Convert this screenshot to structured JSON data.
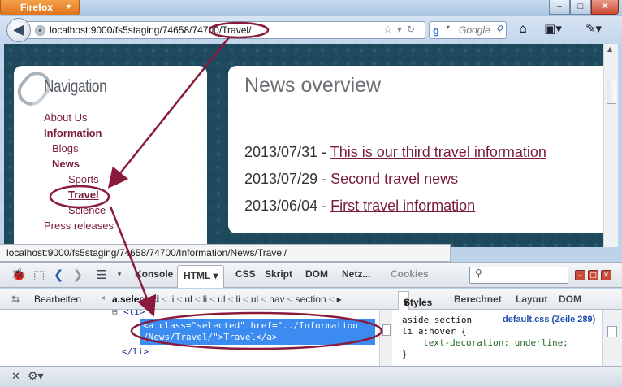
{
  "window": {
    "app_button": "Firefox",
    "min": "–",
    "max": "□",
    "close": "✕"
  },
  "nav": {
    "back_icon": "back-arrow-icon",
    "back_glyph": "◀",
    "url": "localhost:9000/fs5staging/74658/74700/Travel/",
    "search_placeholder": "Google",
    "google_glyph": "g"
  },
  "sidebar": {
    "title": "Navigation",
    "items": [
      {
        "label": "About Us",
        "level": 1
      },
      {
        "label": "Information",
        "level": 1,
        "bold": true
      },
      {
        "label": "Blogs",
        "level": 2
      },
      {
        "label": "News",
        "level": 2,
        "bold": true
      },
      {
        "label": "Sports",
        "level": 3
      },
      {
        "label": "Travel",
        "level": 3,
        "selected": true
      },
      {
        "label": "Science",
        "level": 3
      },
      {
        "label": "Press releases",
        "level": 1
      }
    ]
  },
  "news": {
    "title": "News overview",
    "items": [
      {
        "date": "2013/07/31",
        "sep": " - ",
        "link": "This is our third travel information"
      },
      {
        "date": "2013/07/29",
        "sep": " - ",
        "link": "Second travel news"
      },
      {
        "date": "2013/06/04",
        "sep": " - ",
        "link": "First travel information"
      }
    ]
  },
  "statusbar": {
    "text": "localhost:9000/fs5staging/74658/74700/Information/News/Travel/"
  },
  "firebug": {
    "tabs": [
      "Konsole",
      "HTML",
      "CSS",
      "Skript",
      "DOM",
      "Netz...",
      "Cookies"
    ],
    "selected_tab": "HTML",
    "dropdown_glyph": "▾",
    "breadcrumb_edit": "Bearbeiten",
    "breadcrumbs": [
      "a.selected",
      "li",
      "ul",
      "li",
      "ul",
      "li",
      "ul",
      "nav",
      "section"
    ],
    "html_lines": {
      "li_open": "<li>",
      "li_close": "</li>",
      "selected_1": "<a class=\"selected\" href=\"../Information",
      "selected_2": "/News/Travel/\">Travel</a>"
    },
    "side_tabs": [
      "Styles",
      "Berechnet",
      "Layout",
      "DOM"
    ],
    "css": {
      "selector_1": "aside section",
      "selector_2": "li a:hover {",
      "property": "text-decoration: underline;",
      "close": "}",
      "source": "default.css (Zeile 289)"
    }
  },
  "colors": {
    "accent": "#7a1d3b",
    "highlight": "#3b8bf0",
    "page_bg": "#1f4a5e"
  }
}
